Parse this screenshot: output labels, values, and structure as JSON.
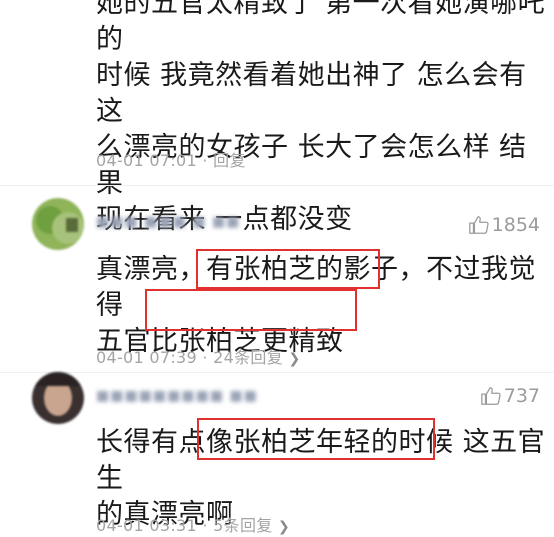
{
  "comment0": {
    "lines": [
      "她的五官太精致了 第一次看她演哪吒的",
      "时候 我竟然看着她出神了 怎么会有这",
      "么漂亮的女孩子 长大了会怎么样 结果",
      "现在看来 一点都没变"
    ],
    "time": "04-01 07:01",
    "dot": "·",
    "reply_label": "回复"
  },
  "comment1": {
    "username": "■■■ ■■■ ■ ■■",
    "likes": "1854",
    "lines": [
      "真漂亮，有张柏芝的影子，不过我觉得",
      "五官比张柏芝更精致"
    ],
    "highlights": [
      "有张柏芝的影子",
      "比张柏芝更精致"
    ],
    "time": "04-01 07:39",
    "dot": "·",
    "reply_label": "24条回复",
    "chevron": "❯"
  },
  "comment2": {
    "username": "■■■■■■■■■ ■■",
    "likes": "737",
    "lines": [
      "长得有点像张柏芝年轻的时候 这五官生",
      "的真漂亮啊"
    ],
    "highlights": [
      "像张柏芝年轻的时候"
    ],
    "time": "04-01 03:31",
    "dot": "·",
    "reply_label": "5条回复",
    "chevron": "❯"
  },
  "colors": {
    "highlight_border": "#e0312f",
    "meta_text": "#a4a4a4",
    "like_text": "#9b9b9b"
  },
  "icons": [
    "thumbs-up-icon",
    "chevron-right-icon"
  ]
}
